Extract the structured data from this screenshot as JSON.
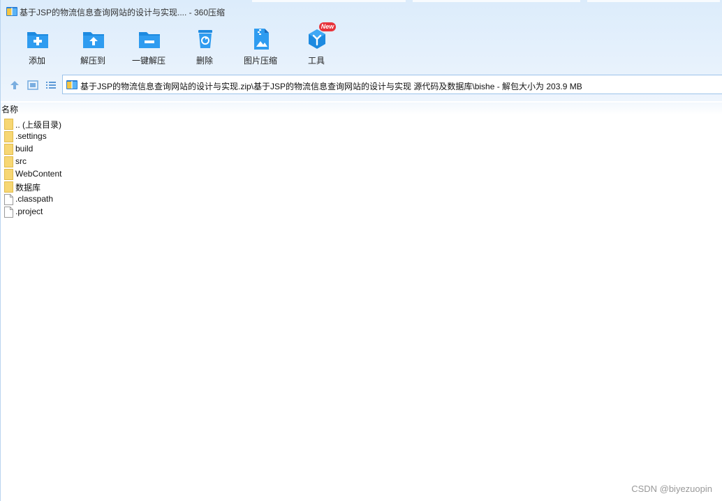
{
  "window": {
    "title": "基于JSP的物流信息查询网站的设计与实现.... - 360压缩"
  },
  "toolbar": {
    "items": [
      {
        "label": "添加",
        "icon": "folder-add-icon"
      },
      {
        "label": "解压到",
        "icon": "folder-extract-icon"
      },
      {
        "label": "一键解压",
        "icon": "folder-quick-extract-icon"
      },
      {
        "label": "删除",
        "icon": "trash-icon"
      },
      {
        "label": "图片压缩",
        "icon": "image-compress-icon"
      },
      {
        "label": "工具",
        "icon": "tools-icon",
        "badge": "New"
      }
    ]
  },
  "nav": {
    "address": "基于JSP的物流信息查询网站的设计与实现.zip\\基于JSP的物流信息查询网站的设计与实现 源代码及数据库\\bishe - 解包大小为 203.9 MB"
  },
  "list": {
    "column_name": "名称",
    "items": [
      {
        "name": ".. (上级目录)",
        "type": "folder"
      },
      {
        "name": ".settings",
        "type": "folder"
      },
      {
        "name": "build",
        "type": "folder"
      },
      {
        "name": "src",
        "type": "folder"
      },
      {
        "name": "WebContent",
        "type": "folder"
      },
      {
        "name": "数据库",
        "type": "folder"
      },
      {
        "name": ".classpath",
        "type": "file"
      },
      {
        "name": ".project",
        "type": "file"
      }
    ]
  },
  "watermark": "CSDN @biyezuopin",
  "colors": {
    "accent": "#1d8ae0",
    "folder": "#f7d774",
    "badge": "#e8333b"
  }
}
